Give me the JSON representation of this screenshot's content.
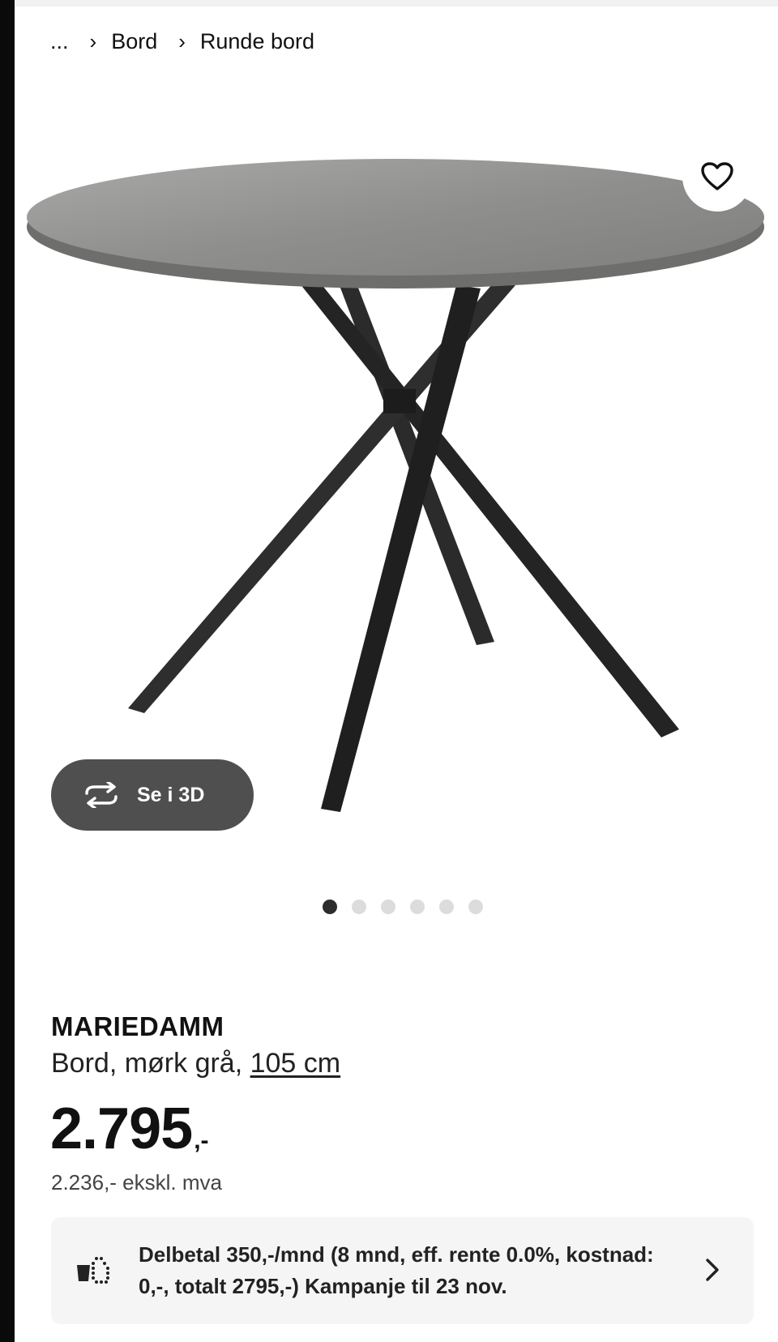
{
  "breadcrumb": {
    "ellipsis": "...",
    "items": [
      "Bord",
      "Runde bord"
    ]
  },
  "gallery": {
    "view_3d_label": "Se i 3D",
    "dots_total": 6,
    "active_index": 0
  },
  "product": {
    "name": "MARIEDAMM",
    "description": "Bord, mørk grå, ",
    "size_link": "105 cm",
    "price_main": "2.795",
    "price_suffix": ",-",
    "price_excl_vat": "2.236,- ekskl. mva"
  },
  "finance": {
    "text": "Delbetal 350,-/mnd (8 mnd, eff. rente 0.0%, kostnad: 0,-, totalt 2795,-) Kampanje til 23 nov."
  },
  "colors": {
    "view3d_bg": "#4f4f4f",
    "finance_bg": "#f5f5f5",
    "dot_active": "#2d2d2d",
    "dot_inactive": "#dcdcdc"
  }
}
